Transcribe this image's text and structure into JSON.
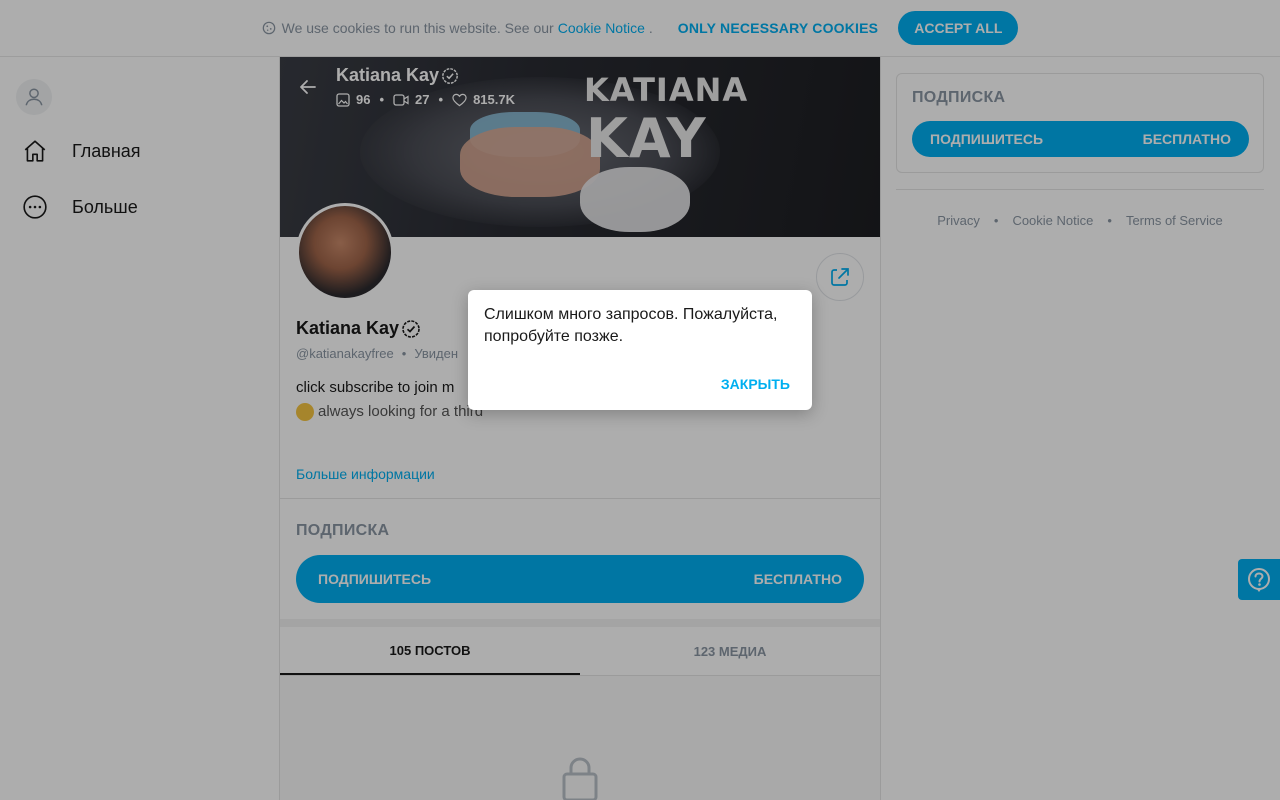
{
  "cookie_bar": {
    "text": "We use cookies to run this website. See our",
    "link": "Cookie Notice",
    "dot": ".",
    "necessary": "ONLY NECESSARY COOKIES",
    "accept": "ACCEPT ALL"
  },
  "nav": {
    "items": [
      {
        "label": "Главная",
        "icon": "home-icon"
      },
      {
        "label": "Больше",
        "icon": "more-icon"
      }
    ]
  },
  "cover": {
    "title": "Katiana Kay",
    "photos": "96",
    "videos": "27",
    "likes": "815.7K",
    "word1": "KATIANA",
    "word2": "KAY"
  },
  "profile": {
    "name": "Katiana Kay",
    "handle": "@katianakayfree",
    "status": "Увиден",
    "bio_line1": "click subscribe to join m",
    "bio_line2": "always looking for a third",
    "more_info": "Больше информации"
  },
  "subscription": {
    "title": "ПОДПИСКА",
    "button_left": "ПОДПИШИТЕСЬ",
    "button_right": "БЕСПЛАТНО"
  },
  "tabs": [
    {
      "label": "105 ПОСТОВ",
      "active": true
    },
    {
      "label": "123 МЕДИА",
      "active": false
    }
  ],
  "footer": {
    "privacy": "Privacy",
    "cookie": "Cookie Notice",
    "terms": "Terms of Service"
  },
  "modal": {
    "message": "Слишком много запросов. Пожалуйста, попробуйте позже.",
    "close": "ЗАКРЫТЬ"
  },
  "colors": {
    "accent": "#00aff0",
    "muted": "#8a96a3"
  }
}
